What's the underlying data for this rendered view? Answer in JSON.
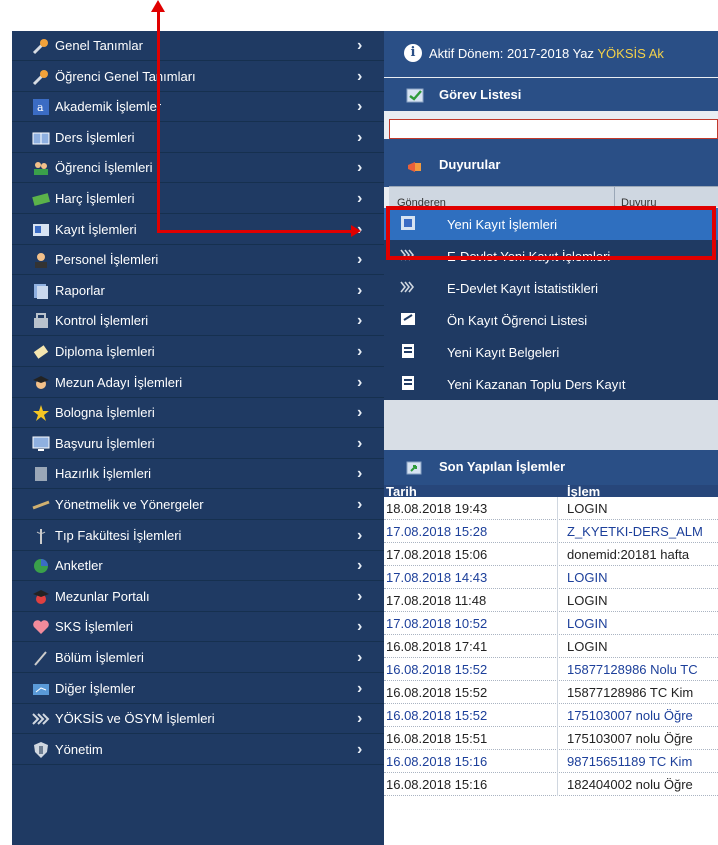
{
  "sidebar": {
    "items": [
      {
        "label": "Genel Tanımlar",
        "icon": "wrench-icon"
      },
      {
        "label": "Öğrenci Genel Tanımları",
        "icon": "wrench-icon"
      },
      {
        "label": "Akademik İşlemler",
        "icon": "academic-icon"
      },
      {
        "label": "Ders İşlemleri",
        "icon": "book-icon"
      },
      {
        "label": "Öğrenci İşlemleri",
        "icon": "students-icon"
      },
      {
        "label": "Harç İşlemleri",
        "icon": "money-icon"
      },
      {
        "label": "Kayıt İşlemleri",
        "icon": "registration-icon"
      },
      {
        "label": "Personel İşlemleri",
        "icon": "personnel-icon"
      },
      {
        "label": "Raporlar",
        "icon": "reports-icon"
      },
      {
        "label": "Kontrol İşlemleri",
        "icon": "control-icon"
      },
      {
        "label": "Diploma İşlemleri",
        "icon": "diploma-icon"
      },
      {
        "label": "Mezun Adayı İşlemleri",
        "icon": "graduate-icon"
      },
      {
        "label": "Bologna İşlemleri",
        "icon": "star-icon"
      },
      {
        "label": "Başvuru İşlemleri",
        "icon": "monitor-icon"
      },
      {
        "label": "Hazırlık İşlemleri",
        "icon": "prep-icon"
      },
      {
        "label": "Yönetmelik ve Yönergeler",
        "icon": "regulation-icon"
      },
      {
        "label": "Tıp Fakültesi İşlemleri",
        "icon": "medical-icon"
      },
      {
        "label": "Anketler",
        "icon": "survey-icon"
      },
      {
        "label": "Mezunlar Portalı",
        "icon": "alumni-icon"
      },
      {
        "label": "SKS İşlemleri",
        "icon": "heart-icon"
      },
      {
        "label": "Bölüm İşlemleri",
        "icon": "department-icon"
      },
      {
        "label": "Diğer İşlemler",
        "icon": "other-icon"
      },
      {
        "label": "YÖKSİS ve ÖSYM İşlemleri",
        "icon": "yoksis-icon"
      },
      {
        "label": "Yönetim",
        "icon": "shield-icon"
      }
    ],
    "chevron": "›"
  },
  "active_period": {
    "prefix": "Aktif Dönem: 2017-2018 Yaz ",
    "highlight": "YÖKSİS Ak"
  },
  "panels": {
    "gorev": "Görev Listesi",
    "duyuru": "Duyurular",
    "son": "Son Yapılan İşlemler",
    "table_ghost_left": "Gönderen",
    "table_ghost_right": "Duyuru"
  },
  "submenu": [
    {
      "label": "Yeni Kayıt İşlemleri",
      "selected": true
    },
    {
      "label": "E-Devlet Yeni Kayıt İşlemleri",
      "selected": false
    },
    {
      "label": "E-Devlet Kayıt İstatistikleri",
      "selected": false
    },
    {
      "label": "Ön Kayıt Öğrenci Listesi",
      "selected": false
    },
    {
      "label": "Yeni Kayıt Belgeleri",
      "selected": false
    },
    {
      "label": "Yeni Kazanan Toplu Ders Kayıt",
      "selected": false
    }
  ],
  "recent": {
    "col_date": "Tarih",
    "col_action": "İşlem",
    "rows": [
      {
        "date": "18.08.2018 19:43",
        "action": "LOGIN",
        "style": "dark"
      },
      {
        "date": "17.08.2018 15:28",
        "action": "Z_KYETKI-DERS_ALM",
        "style": "blue"
      },
      {
        "date": "17.08.2018 15:06",
        "action": "donemid:20181 hafta",
        "style": "dark"
      },
      {
        "date": "17.08.2018 14:43",
        "action": "LOGIN",
        "style": "blue"
      },
      {
        "date": "17.08.2018 11:48",
        "action": "LOGIN",
        "style": "dark"
      },
      {
        "date": "17.08.2018 10:52",
        "action": "LOGIN",
        "style": "blue"
      },
      {
        "date": "16.08.2018 17:41",
        "action": "LOGIN",
        "style": "dark"
      },
      {
        "date": "16.08.2018 15:52",
        "action": "15877128986 Nolu TC",
        "style": "blue"
      },
      {
        "date": "16.08.2018 15:52",
        "action": "15877128986 TC Kim",
        "style": "dark"
      },
      {
        "date": "16.08.2018 15:52",
        "action": "175103007 nolu Öğre",
        "style": "blue"
      },
      {
        "date": "16.08.2018 15:51",
        "action": "175103007 nolu Öğre",
        "style": "dark"
      },
      {
        "date": "16.08.2018 15:16",
        "action": "98715651189 TC Kim",
        "style": "blue"
      },
      {
        "date": "16.08.2018 15:16",
        "action": "182404002 nolu Öğre",
        "style": "dark"
      }
    ]
  }
}
